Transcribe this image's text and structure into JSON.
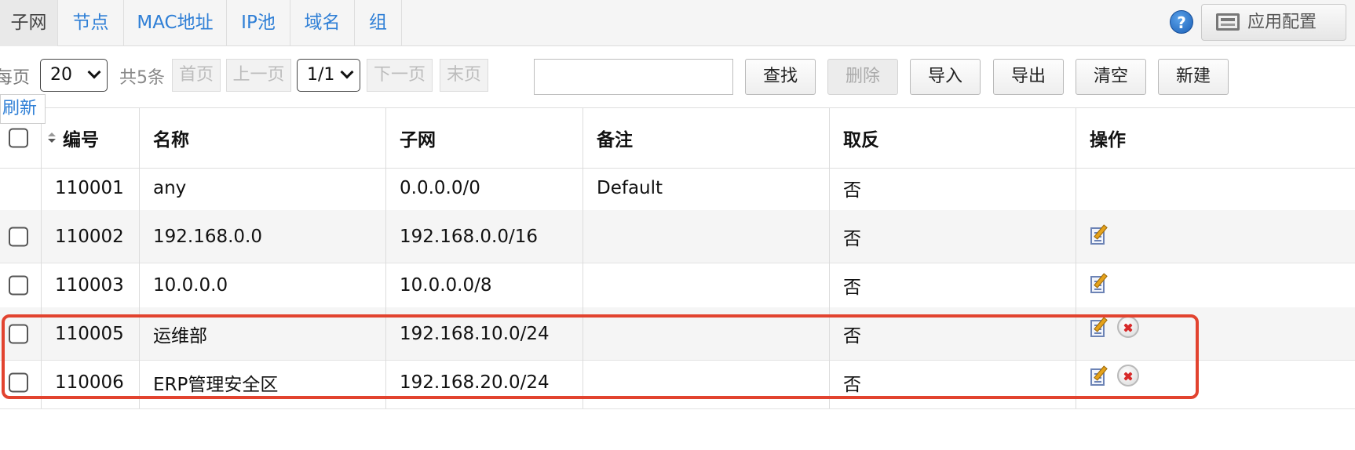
{
  "tabs": [
    {
      "label": "子网",
      "active": true
    },
    {
      "label": "节点",
      "active": false
    },
    {
      "label": "MAC地址",
      "active": false
    },
    {
      "label": "IP池",
      "active": false
    },
    {
      "label": "域名",
      "active": false
    },
    {
      "label": "组",
      "active": false
    }
  ],
  "header": {
    "help_icon": "?",
    "apply_config_label": "应用配置"
  },
  "toolbar": {
    "per_page_label": "每页",
    "per_page_value": "20",
    "total_label": "共5条",
    "first_page": "首页",
    "prev_page": "上一页",
    "page_select_value": "1/1",
    "next_page": "下一页",
    "last_page": "末页",
    "search_placeholder": "",
    "search_button": "查找",
    "delete_button": "删除",
    "import_button": "导入",
    "export_button": "导出",
    "clear_button": "清空",
    "new_button": "新建",
    "refresh_label": "刷新"
  },
  "table": {
    "columns": [
      "编号",
      "名称",
      "子网",
      "备注",
      "取反",
      "操作"
    ],
    "rows": [
      {
        "id": "110001",
        "name": "any",
        "subnet": "0.0.0.0/0",
        "remark": "Default",
        "invert": "否",
        "checkbox": false,
        "edit": false,
        "delete": false
      },
      {
        "id": "110002",
        "name": "192.168.0.0",
        "subnet": "192.168.0.0/16",
        "remark": "",
        "invert": "否",
        "checkbox": true,
        "edit": true,
        "delete": false
      },
      {
        "id": "110003",
        "name": "10.0.0.0",
        "subnet": "10.0.0.0/8",
        "remark": "",
        "invert": "否",
        "checkbox": true,
        "edit": true,
        "delete": false
      },
      {
        "id": "110005",
        "name": "运维部",
        "subnet": "192.168.10.0/24",
        "remark": "",
        "invert": "否",
        "checkbox": true,
        "edit": true,
        "delete": true
      },
      {
        "id": "110006",
        "name": "ERP管理安全区",
        "subnet": "192.168.20.0/24",
        "remark": "",
        "invert": "否",
        "checkbox": true,
        "edit": true,
        "delete": true
      }
    ]
  },
  "colors": {
    "link_blue": "#2f7fd6",
    "highlight_red": "#e2432f",
    "alt_row": "#f5f5f5"
  },
  "icons": {
    "edit": "edit-icon",
    "delete": "delete-icon",
    "help": "help-icon",
    "sort": "sort-icon"
  }
}
